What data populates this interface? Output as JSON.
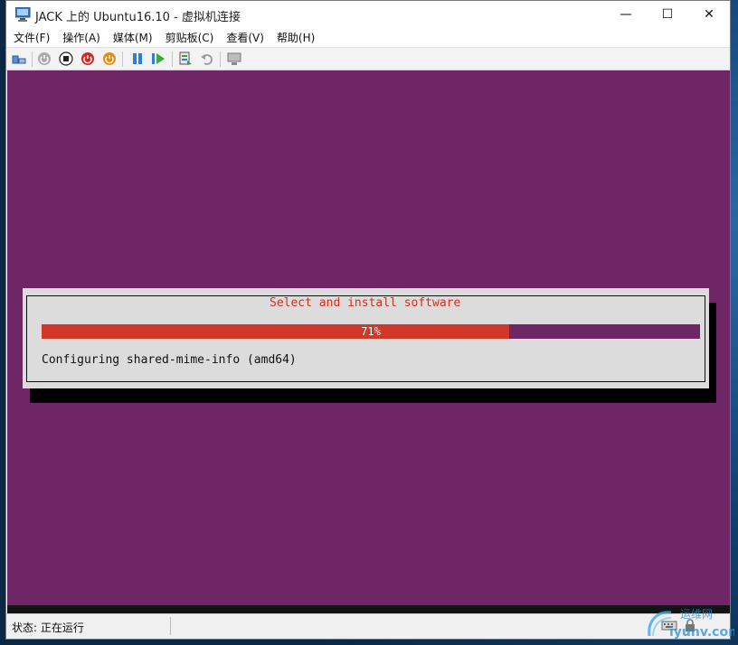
{
  "window": {
    "title": "JACK 上的 Ubuntu16.10 - 虚拟机连接",
    "minimize_glyph": "—",
    "maximize_glyph": "☐",
    "close_glyph": "✕"
  },
  "menu": {
    "items": [
      {
        "label": "文件(F)"
      },
      {
        "label": "操作(A)"
      },
      {
        "label": "媒体(M)"
      },
      {
        "label": "剪贴板(C)"
      },
      {
        "label": "查看(V)"
      },
      {
        "label": "帮助(H)"
      }
    ]
  },
  "toolbar": {
    "icons": [
      "ctrl-alt-del-icon",
      "start-icon",
      "turn-off-icon",
      "shutdown-icon",
      "save-icon",
      "pause-icon",
      "reset-icon",
      "checkpoint-icon",
      "revert-icon",
      "enhanced-session-icon"
    ]
  },
  "installer": {
    "dialog_title": "Select and install software",
    "progress_percent": 71,
    "progress_label": "71%",
    "message": "Configuring shared-mime-info (amd64)",
    "colors": {
      "background": "#6f2667",
      "progress": "#d0392a",
      "title": "#d4301f",
      "dialog": "#dcdcdc"
    }
  },
  "statusbar": {
    "text": "状态: 正在运行"
  }
}
